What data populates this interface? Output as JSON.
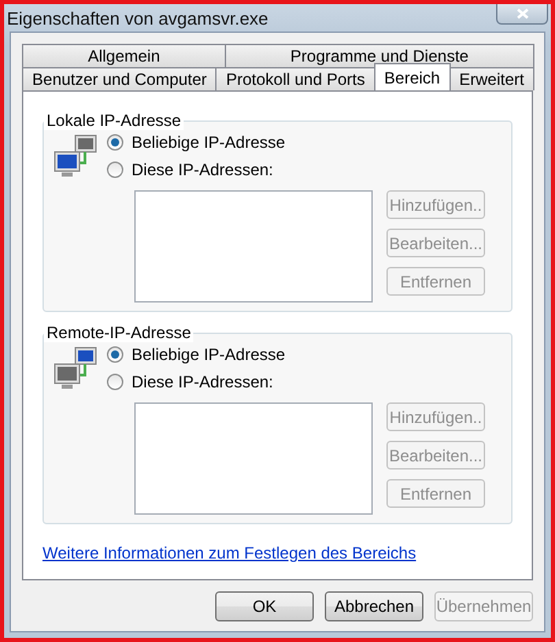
{
  "window": {
    "title": "Eigenschaften von avgamsvr.exe"
  },
  "tab_rows": [
    [
      {
        "label": "Allgemein",
        "selected": false
      },
      {
        "label": "Programme und Dienste",
        "selected": false
      }
    ],
    [
      {
        "label": "Benutzer und Computer",
        "selected": false
      },
      {
        "label": "Protokoll und Ports",
        "selected": false
      },
      {
        "label": "Bereich",
        "selected": true
      },
      {
        "label": "Erweitert",
        "selected": false
      }
    ]
  ],
  "groups": [
    {
      "title": "Lokale IP-Adresse",
      "kind": "local",
      "options": [
        {
          "label": "Beliebige IP-Adresse",
          "selected": true
        },
        {
          "label": "Diese IP-Adressen:",
          "selected": false
        }
      ],
      "buttons": [
        {
          "label": "Hinzufügen..",
          "disabled": true
        },
        {
          "label": "Bearbeiten...",
          "disabled": true
        },
        {
          "label": "Entfernen",
          "disabled": true
        }
      ]
    },
    {
      "title": "Remote-IP-Adresse",
      "kind": "remote",
      "options": [
        {
          "label": "Beliebige IP-Adresse",
          "selected": true
        },
        {
          "label": "Diese IP-Adressen:",
          "selected": false
        }
      ],
      "buttons": [
        {
          "label": "Hinzufügen..",
          "disabled": true
        },
        {
          "label": "Bearbeiten...",
          "disabled": true
        },
        {
          "label": "Entfernen",
          "disabled": true
        }
      ]
    }
  ],
  "link": "Weitere Informationen zum Festlegen des Bereichs",
  "footer_buttons": [
    {
      "label": "OK",
      "disabled": false
    },
    {
      "label": "Abbrechen",
      "disabled": false
    },
    {
      "label": "Übernehmen",
      "disabled": true
    }
  ]
}
